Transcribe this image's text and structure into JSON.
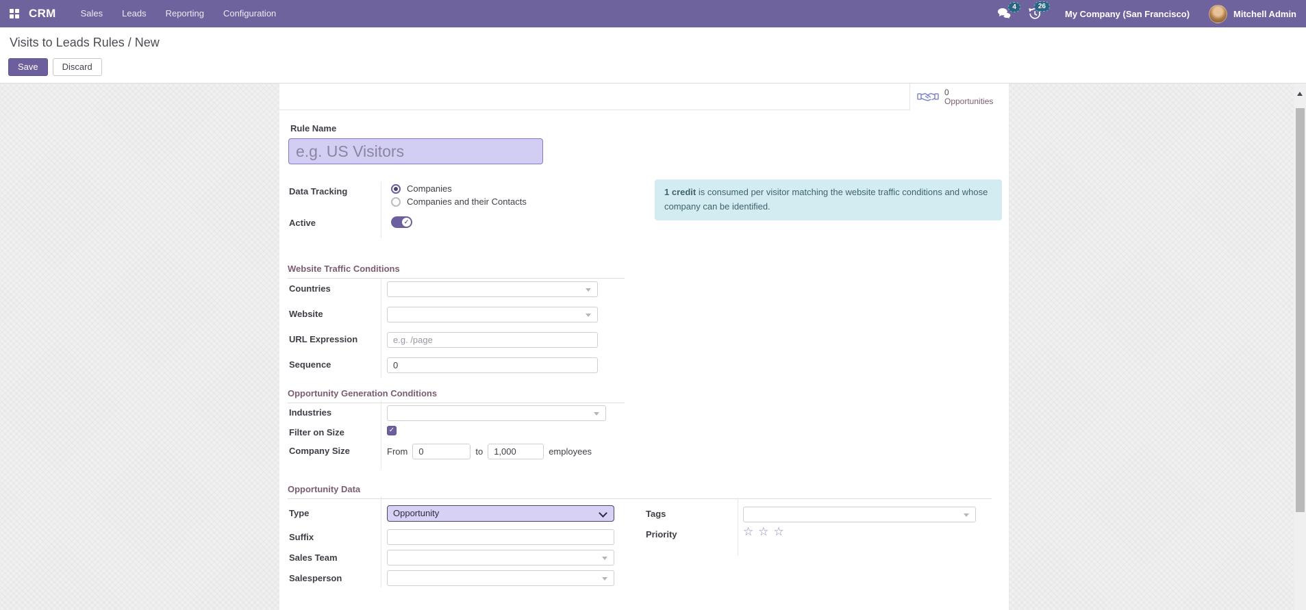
{
  "colors": {
    "primary": "#6e639c",
    "badge": "#2a6485",
    "alert_bg": "#d2ecf2",
    "highlight_input_bg": "#d2cdf3"
  },
  "navbar": {
    "brand": "CRM",
    "menus": [
      "Sales",
      "Leads",
      "Reporting",
      "Configuration"
    ],
    "messages_badge": "4",
    "activities_badge": "26",
    "company": "My Company (San Francisco)",
    "user": "Mitchell Admin"
  },
  "breadcrumb": {
    "path": "Visits to Leads Rules",
    "separator": " / ",
    "current": "New"
  },
  "actions": {
    "save": "Save",
    "discard": "Discard"
  },
  "stat_button": {
    "count": "0",
    "label": "Opportunities"
  },
  "alert": {
    "emphasis": "1 credit",
    "text": " is consumed per visitor matching the website traffic conditions and whose company can be identified."
  },
  "icons": {
    "star_empty": "☆"
  },
  "form": {
    "rule_name": {
      "label": "Rule Name",
      "placeholder": "e.g. US Visitors",
      "value": ""
    },
    "data_tracking": {
      "label": "Data Tracking",
      "option_companies": "Companies",
      "option_companies_contacts": "Companies and their Contacts",
      "selected": "Companies"
    },
    "active": {
      "label": "Active",
      "value": "on"
    },
    "traffic_section": {
      "title": "Website Traffic Conditions"
    },
    "countries": {
      "label": "Countries",
      "value": ""
    },
    "website": {
      "label": "Website",
      "value": ""
    },
    "url_expression": {
      "label": "URL Expression",
      "placeholder": "e.g. /page",
      "value": ""
    },
    "sequence": {
      "label": "Sequence",
      "value": "0"
    },
    "generation_section": {
      "title": "Opportunity Generation Conditions"
    },
    "industries": {
      "label": "Industries",
      "value": ""
    },
    "filter_on_size": {
      "label": "Filter on Size",
      "checked": true
    },
    "company_size": {
      "label": "Company Size",
      "from_label": "From",
      "from_value": "0",
      "to_label": "to",
      "to_value": "1,000",
      "unit": "employees"
    },
    "opportunity_section": {
      "title": "Opportunity Data"
    },
    "type": {
      "label": "Type",
      "value": "Opportunity"
    },
    "suffix": {
      "label": "Suffix",
      "value": ""
    },
    "sales_team": {
      "label": "Sales Team",
      "value": ""
    },
    "salesperson": {
      "label": "Salesperson",
      "value": ""
    },
    "tags": {
      "label": "Tags",
      "value": ""
    },
    "priority": {
      "label": "Priority",
      "max_stars": 3,
      "selected": 0
    }
  }
}
